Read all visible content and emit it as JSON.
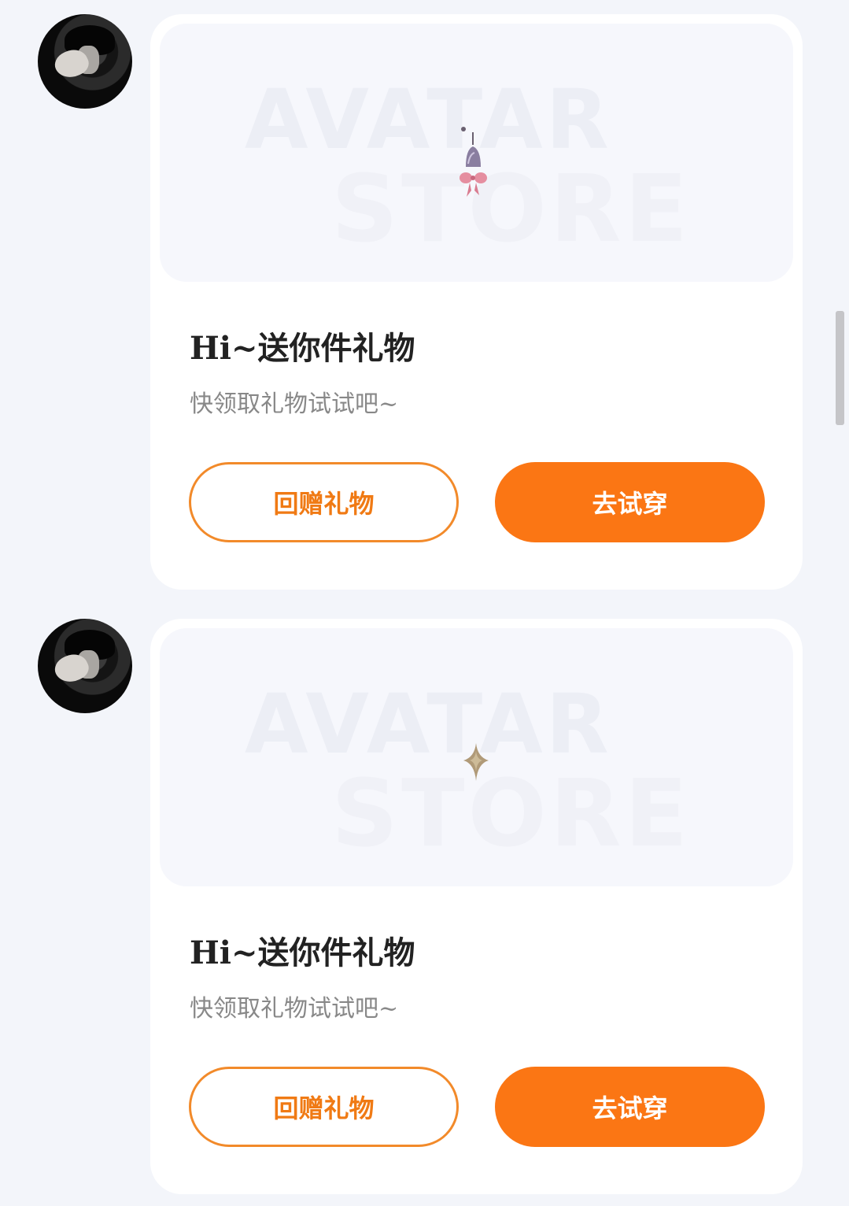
{
  "colors": {
    "page_background": "#f3f5fa",
    "card_background": "#ffffff",
    "accent_orange": "#fb7614",
    "title_text": "#222222",
    "subtitle_text": "#888888"
  },
  "messages": [
    {
      "watermark_line1": "AVATAR",
      "watermark_line2": "STORE",
      "item_icon": "bell-charm-icon",
      "title": "Hi~送你件礼物",
      "subtitle": "快领取礼物试试吧~",
      "return_gift_label": "回赠礼物",
      "try_on_label": "去试穿"
    },
    {
      "watermark_line1": "AVATAR",
      "watermark_line2": "STORE",
      "item_icon": "sparkle-icon",
      "title": "Hi~送你件礼物",
      "subtitle": "快领取礼物试试吧~",
      "return_gift_label": "回赠礼物",
      "try_on_label": "去试穿"
    }
  ]
}
